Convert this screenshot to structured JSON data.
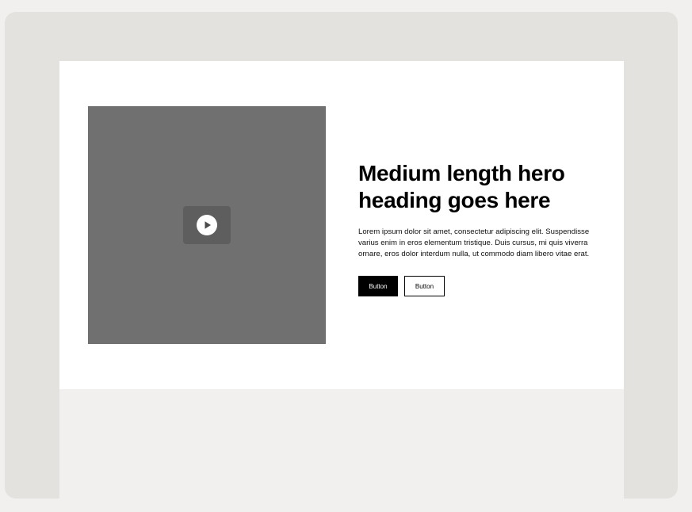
{
  "hero": {
    "heading": "Medium length hero heading goes here",
    "paragraph": "Lorem ipsum dolor sit amet, consectetur adipiscing elit. Suspendisse varius enim in eros elementum tristique. Duis cursus, mi quis viverra ornare, eros dolor interdum nulla, ut commodo diam libero vitae erat.",
    "primary_button_label": "Button",
    "secondary_button_label": "Button"
  },
  "media": {
    "icon": "play-icon"
  },
  "colors": {
    "page_bg": "#f1f0ee",
    "frame_bg": "#e3e2df",
    "hero_bg": "#ffffff",
    "media_bg": "#707070",
    "play_button_bg": "#5e5e5e",
    "primary_button_bg": "#000000",
    "text": "#000000"
  }
}
